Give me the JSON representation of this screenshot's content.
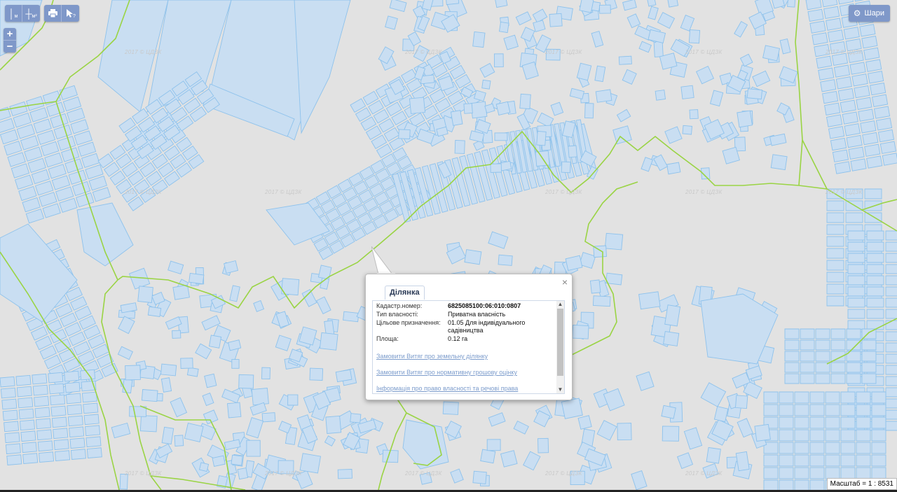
{
  "toolbar": {
    "measure_distance_label": "м",
    "measure_area_label": "м²",
    "print_icon": "print-icon",
    "identify_icon": "identify-cursor-icon"
  },
  "zoom": {
    "in_label": "+",
    "out_label": "−"
  },
  "layers_button": {
    "label": "Шари",
    "icon": "gear-icon"
  },
  "watermark": "2017 © ЦДЗК",
  "popup": {
    "tab_label": "Ділянка",
    "close_label": "×",
    "fields": [
      {
        "label": "Кадастр.номер:",
        "value": "6825085100:06:010:0807"
      },
      {
        "label": "Тип власності:",
        "value": "Приватна власність"
      },
      {
        "label": "Цільове призначення:",
        "value": "01.05 Для індивідуального садівництва"
      },
      {
        "label": "Площа:",
        "value": "0.12 га"
      }
    ],
    "links": [
      "Замовити Витяг про земельну ділянку",
      "Замовити Витяг про нормативну грошову оцінку",
      "Інформація про право власності та речові права"
    ]
  },
  "scale": {
    "text": "Масштаб = 1 : 8531"
  },
  "colors": {
    "background": "#e2e2e2",
    "parcel_fill": "#c9def2",
    "parcel_stroke": "#8ec2ec",
    "boundary": "#9ad444",
    "control": "#7f98c9"
  }
}
